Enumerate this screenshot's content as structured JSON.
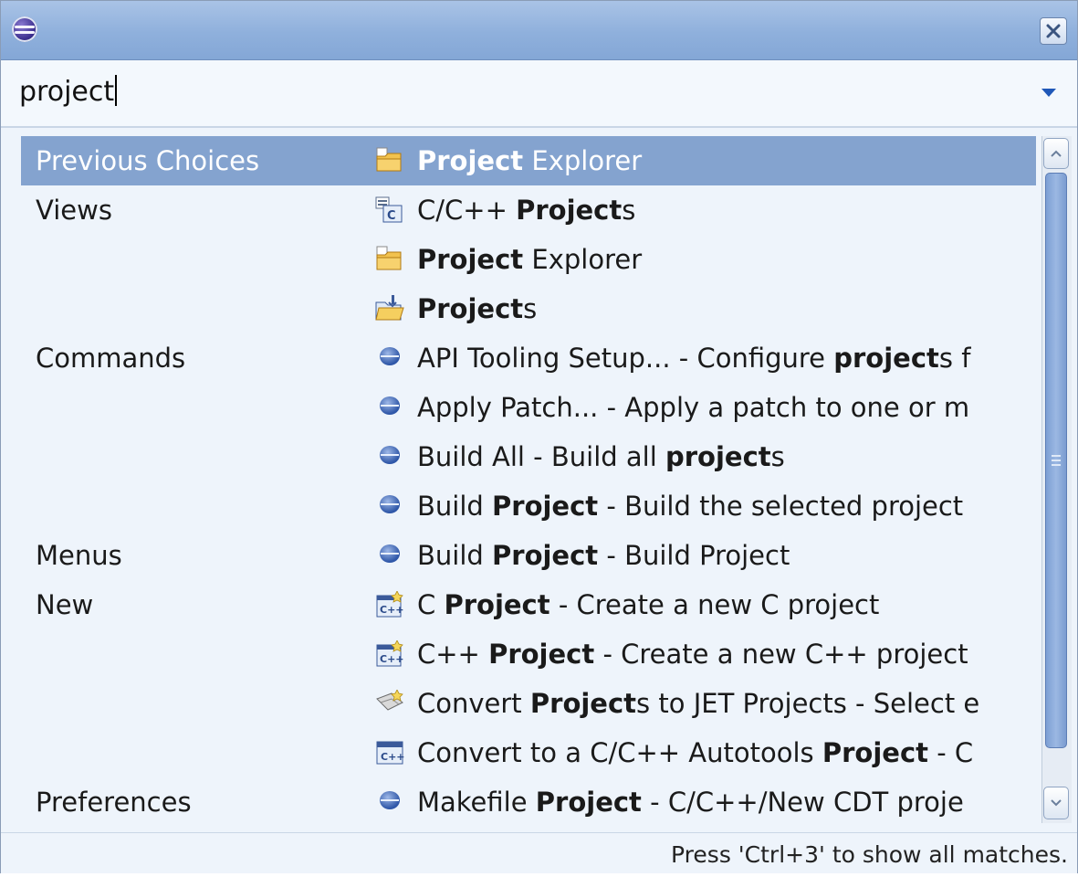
{
  "search": {
    "query": "project"
  },
  "rows": [
    {
      "category": "Previous Choices",
      "icon": "project-explorer-icon",
      "selected": true,
      "label": [
        {
          "t": "Project",
          "b": true
        },
        {
          "t": " Explorer",
          "b": false
        }
      ]
    },
    {
      "category": "Views",
      "icon": "cpp-projects-view-icon",
      "label": [
        {
          "t": "C/C++ ",
          "b": false
        },
        {
          "t": "Project",
          "b": true
        },
        {
          "t": "s",
          "b": false
        }
      ]
    },
    {
      "category": "",
      "icon": "project-explorer-icon",
      "label": [
        {
          "t": "Project",
          "b": true
        },
        {
          "t": " Explorer",
          "b": false
        }
      ]
    },
    {
      "category": "",
      "icon": "projects-folder-icon",
      "label": [
        {
          "t": "Project",
          "b": true
        },
        {
          "t": "s",
          "b": false
        }
      ]
    },
    {
      "category": "Commands",
      "icon": "command-bullet-icon",
      "label": [
        {
          "t": "API Tooling Setup... - Configure ",
          "b": false
        },
        {
          "t": "project",
          "b": true
        },
        {
          "t": "s f",
          "b": false
        }
      ]
    },
    {
      "category": "",
      "icon": "command-bullet-icon",
      "label": [
        {
          "t": "Apply Patch... - Apply a patch to one or m",
          "b": false
        }
      ]
    },
    {
      "category": "",
      "icon": "command-bullet-icon",
      "label": [
        {
          "t": "Build All - Build all ",
          "b": false
        },
        {
          "t": "project",
          "b": true
        },
        {
          "t": "s",
          "b": false
        }
      ]
    },
    {
      "category": "",
      "icon": "command-bullet-icon",
      "label": [
        {
          "t": "Build ",
          "b": false
        },
        {
          "t": "Project",
          "b": true
        },
        {
          "t": " - Build the selected project",
          "b": false
        }
      ]
    },
    {
      "category": "Menus",
      "icon": "command-bullet-icon",
      "label": [
        {
          "t": "Build ",
          "b": false
        },
        {
          "t": "Project",
          "b": true
        },
        {
          "t": " - Build Project",
          "b": false
        }
      ]
    },
    {
      "category": "New",
      "icon": "new-cpp-project-icon",
      "label": [
        {
          "t": "C ",
          "b": false
        },
        {
          "t": "Project",
          "b": true
        },
        {
          "t": " - Create a new C project",
          "b": false
        }
      ]
    },
    {
      "category": "",
      "icon": "new-cpp-project-icon",
      "label": [
        {
          "t": "C++ ",
          "b": false
        },
        {
          "t": "Project",
          "b": true
        },
        {
          "t": " - Create a new C++ project",
          "b": false
        }
      ]
    },
    {
      "category": "",
      "icon": "convert-jet-project-icon",
      "label": [
        {
          "t": "Convert ",
          "b": false
        },
        {
          "t": "Project",
          "b": true
        },
        {
          "t": "s to JET Projects - Select e",
          "b": false
        }
      ]
    },
    {
      "category": "",
      "icon": "cpp-autotools-icon",
      "label": [
        {
          "t": "Convert to a C/C++ Autotools ",
          "b": false
        },
        {
          "t": "Project",
          "b": true
        },
        {
          "t": " - C",
          "b": false
        }
      ]
    },
    {
      "category": "Preferences",
      "icon": "command-bullet-icon",
      "label": [
        {
          "t": "Makefile ",
          "b": false
        },
        {
          "t": "Project",
          "b": true
        },
        {
          "t": " - C/C++/New CDT proje",
          "b": false
        }
      ]
    }
  ],
  "status": {
    "text": "Press 'Ctrl+3' to show all matches."
  },
  "colors": {
    "selection": "#84a3cf",
    "titlebar": "#8fb0dc",
    "background": "#eef4fb",
    "accent": "#1f58b8"
  }
}
